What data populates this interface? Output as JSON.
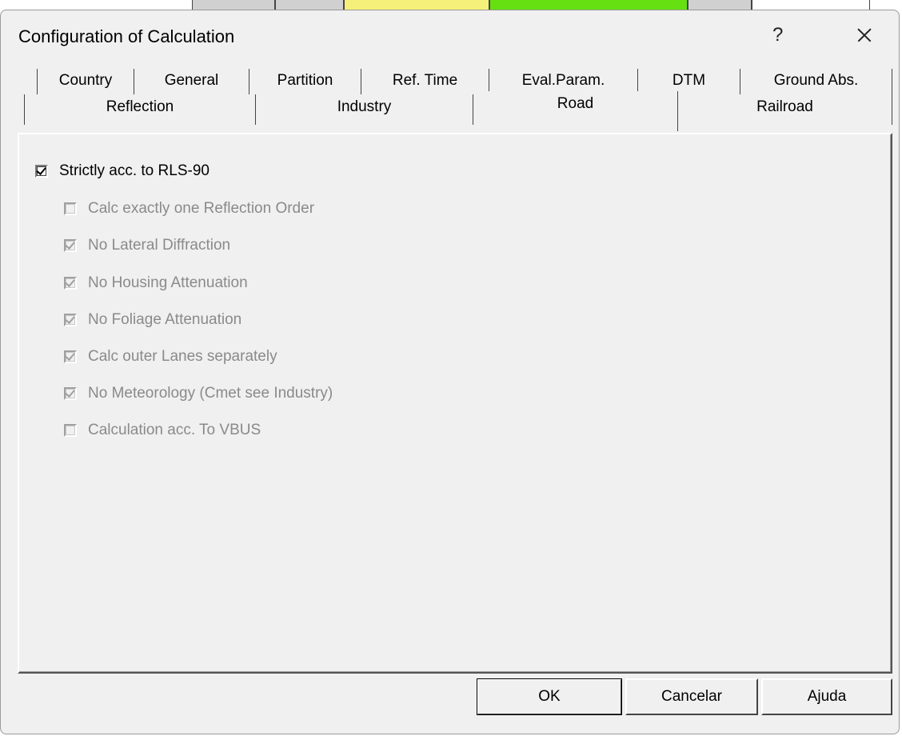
{
  "window": {
    "title": "Configuration of Calculation",
    "help_label": "?"
  },
  "tabs": {
    "row1": [
      {
        "label": "Country"
      },
      {
        "label": "General"
      },
      {
        "label": "Partition"
      },
      {
        "label": "Ref. Time"
      },
      {
        "label": "Eval.Param."
      },
      {
        "label": "DTM"
      },
      {
        "label": "Ground Abs."
      }
    ],
    "row2": [
      {
        "label": "Reflection"
      },
      {
        "label": "Industry"
      },
      {
        "label": "Road",
        "active": true
      },
      {
        "label": "Railroad"
      }
    ]
  },
  "options": [
    {
      "label": "Strictly acc. to RLS-90",
      "checked": true,
      "enabled": true
    },
    {
      "label": "Calc exactly one Reflection Order",
      "checked": false,
      "enabled": false
    },
    {
      "label": "No Lateral Diffraction",
      "checked": true,
      "enabled": false
    },
    {
      "label": "No Housing Attenuation",
      "checked": true,
      "enabled": false
    },
    {
      "label": "No Foliage Attenuation",
      "checked": true,
      "enabled": false
    },
    {
      "label": "Calc outer Lanes separately",
      "checked": true,
      "enabled": false
    },
    {
      "label": "No Meteorology (Cmet see Industry)",
      "checked": true,
      "enabled": false
    },
    {
      "label": "Calculation acc. To VBUS",
      "checked": false,
      "enabled": false
    }
  ],
  "buttons": {
    "ok": "OK",
    "cancel": "Cancelar",
    "help": "Ajuda"
  },
  "colors": {
    "dialog_bg": "#f0f0f0",
    "disabled_text": "#8a8a8a",
    "bg_yellow": "#f5f07a",
    "bg_green": "#66e010",
    "bg_gray": "#d0d0d0"
  }
}
